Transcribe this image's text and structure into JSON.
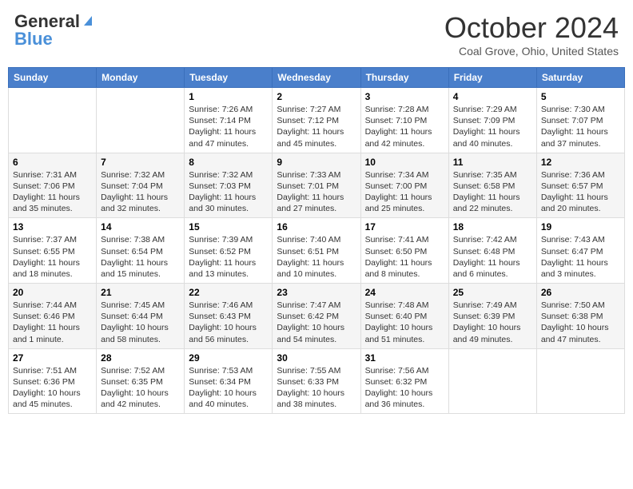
{
  "header": {
    "logo_general": "General",
    "logo_blue": "Blue",
    "title": "October 2024",
    "location": "Coal Grove, Ohio, United States"
  },
  "days_of_week": [
    "Sunday",
    "Monday",
    "Tuesday",
    "Wednesday",
    "Thursday",
    "Friday",
    "Saturday"
  ],
  "weeks": [
    [
      {
        "day": "",
        "info": ""
      },
      {
        "day": "",
        "info": ""
      },
      {
        "day": "1",
        "info": "Sunrise: 7:26 AM\nSunset: 7:14 PM\nDaylight: 11 hours and 47 minutes."
      },
      {
        "day": "2",
        "info": "Sunrise: 7:27 AM\nSunset: 7:12 PM\nDaylight: 11 hours and 45 minutes."
      },
      {
        "day": "3",
        "info": "Sunrise: 7:28 AM\nSunset: 7:10 PM\nDaylight: 11 hours and 42 minutes."
      },
      {
        "day": "4",
        "info": "Sunrise: 7:29 AM\nSunset: 7:09 PM\nDaylight: 11 hours and 40 minutes."
      },
      {
        "day": "5",
        "info": "Sunrise: 7:30 AM\nSunset: 7:07 PM\nDaylight: 11 hours and 37 minutes."
      }
    ],
    [
      {
        "day": "6",
        "info": "Sunrise: 7:31 AM\nSunset: 7:06 PM\nDaylight: 11 hours and 35 minutes."
      },
      {
        "day": "7",
        "info": "Sunrise: 7:32 AM\nSunset: 7:04 PM\nDaylight: 11 hours and 32 minutes."
      },
      {
        "day": "8",
        "info": "Sunrise: 7:32 AM\nSunset: 7:03 PM\nDaylight: 11 hours and 30 minutes."
      },
      {
        "day": "9",
        "info": "Sunrise: 7:33 AM\nSunset: 7:01 PM\nDaylight: 11 hours and 27 minutes."
      },
      {
        "day": "10",
        "info": "Sunrise: 7:34 AM\nSunset: 7:00 PM\nDaylight: 11 hours and 25 minutes."
      },
      {
        "day": "11",
        "info": "Sunrise: 7:35 AM\nSunset: 6:58 PM\nDaylight: 11 hours and 22 minutes."
      },
      {
        "day": "12",
        "info": "Sunrise: 7:36 AM\nSunset: 6:57 PM\nDaylight: 11 hours and 20 minutes."
      }
    ],
    [
      {
        "day": "13",
        "info": "Sunrise: 7:37 AM\nSunset: 6:55 PM\nDaylight: 11 hours and 18 minutes."
      },
      {
        "day": "14",
        "info": "Sunrise: 7:38 AM\nSunset: 6:54 PM\nDaylight: 11 hours and 15 minutes."
      },
      {
        "day": "15",
        "info": "Sunrise: 7:39 AM\nSunset: 6:52 PM\nDaylight: 11 hours and 13 minutes."
      },
      {
        "day": "16",
        "info": "Sunrise: 7:40 AM\nSunset: 6:51 PM\nDaylight: 11 hours and 10 minutes."
      },
      {
        "day": "17",
        "info": "Sunrise: 7:41 AM\nSunset: 6:50 PM\nDaylight: 11 hours and 8 minutes."
      },
      {
        "day": "18",
        "info": "Sunrise: 7:42 AM\nSunset: 6:48 PM\nDaylight: 11 hours and 6 minutes."
      },
      {
        "day": "19",
        "info": "Sunrise: 7:43 AM\nSunset: 6:47 PM\nDaylight: 11 hours and 3 minutes."
      }
    ],
    [
      {
        "day": "20",
        "info": "Sunrise: 7:44 AM\nSunset: 6:46 PM\nDaylight: 11 hours and 1 minute."
      },
      {
        "day": "21",
        "info": "Sunrise: 7:45 AM\nSunset: 6:44 PM\nDaylight: 10 hours and 58 minutes."
      },
      {
        "day": "22",
        "info": "Sunrise: 7:46 AM\nSunset: 6:43 PM\nDaylight: 10 hours and 56 minutes."
      },
      {
        "day": "23",
        "info": "Sunrise: 7:47 AM\nSunset: 6:42 PM\nDaylight: 10 hours and 54 minutes."
      },
      {
        "day": "24",
        "info": "Sunrise: 7:48 AM\nSunset: 6:40 PM\nDaylight: 10 hours and 51 minutes."
      },
      {
        "day": "25",
        "info": "Sunrise: 7:49 AM\nSunset: 6:39 PM\nDaylight: 10 hours and 49 minutes."
      },
      {
        "day": "26",
        "info": "Sunrise: 7:50 AM\nSunset: 6:38 PM\nDaylight: 10 hours and 47 minutes."
      }
    ],
    [
      {
        "day": "27",
        "info": "Sunrise: 7:51 AM\nSunset: 6:36 PM\nDaylight: 10 hours and 45 minutes."
      },
      {
        "day": "28",
        "info": "Sunrise: 7:52 AM\nSunset: 6:35 PM\nDaylight: 10 hours and 42 minutes."
      },
      {
        "day": "29",
        "info": "Sunrise: 7:53 AM\nSunset: 6:34 PM\nDaylight: 10 hours and 40 minutes."
      },
      {
        "day": "30",
        "info": "Sunrise: 7:55 AM\nSunset: 6:33 PM\nDaylight: 10 hours and 38 minutes."
      },
      {
        "day": "31",
        "info": "Sunrise: 7:56 AM\nSunset: 6:32 PM\nDaylight: 10 hours and 36 minutes."
      },
      {
        "day": "",
        "info": ""
      },
      {
        "day": "",
        "info": ""
      }
    ]
  ]
}
